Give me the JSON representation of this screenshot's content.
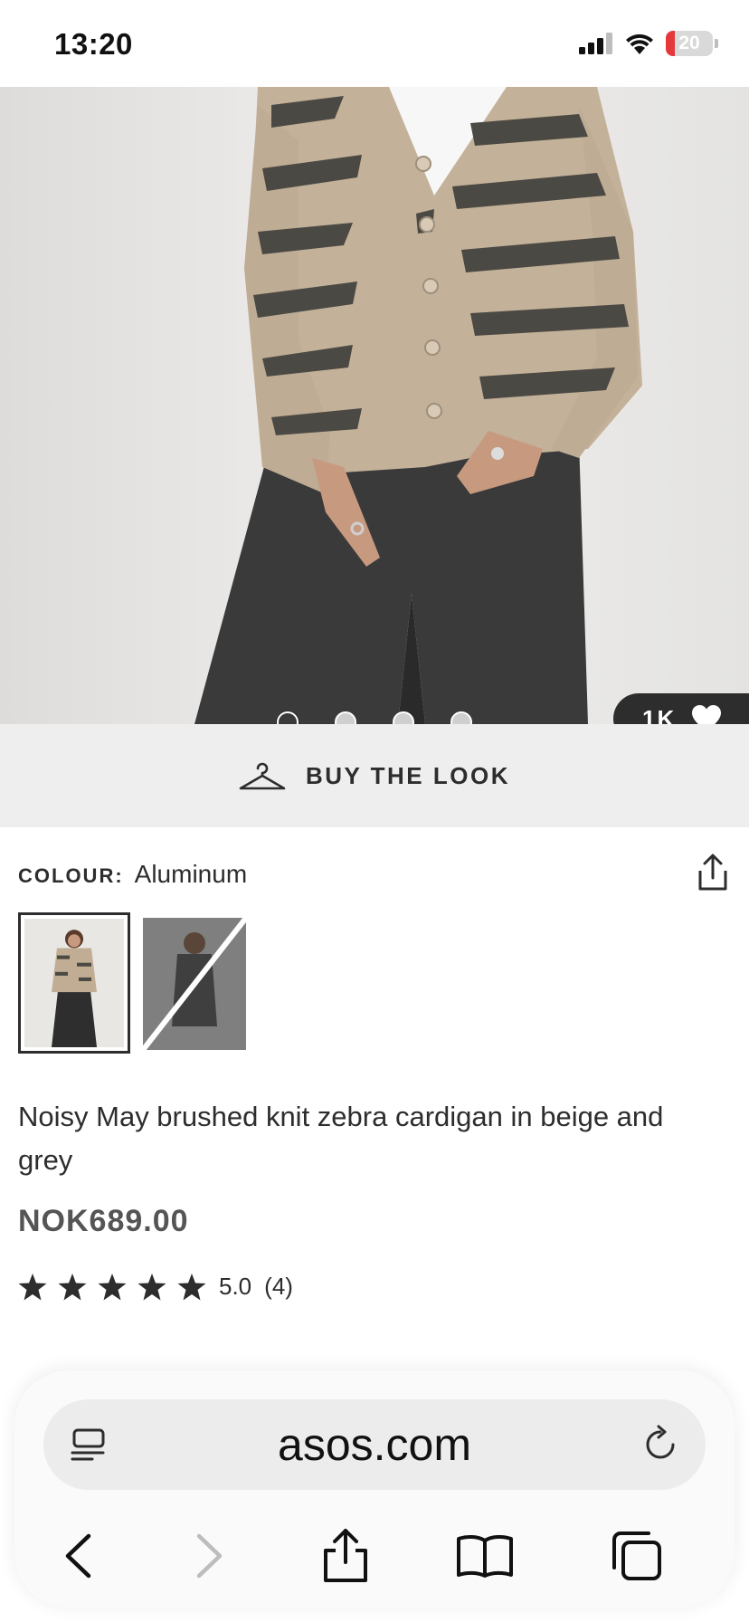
{
  "status_bar": {
    "time": "13:20",
    "battery": "20",
    "battery_level": 0.2
  },
  "gallery": {
    "image_count": 4,
    "active_index": 0,
    "save_count": "1K"
  },
  "buy_the_look": {
    "label": "BUY THE LOOK"
  },
  "colour": {
    "label": "COLOUR:",
    "value": "Aluminum"
  },
  "product": {
    "title": "Noisy May brushed knit zebra cardigan in beige and grey",
    "price": "NOK689.00",
    "rating": {
      "stars": 5,
      "value": "5.0",
      "count": "(4)"
    }
  },
  "browser": {
    "url": "asos.com"
  },
  "colors": {
    "text": "#2d2d2d",
    "price": "#555555",
    "battery_low": "#e5383b",
    "buy_look_bg": "#eeeeee"
  },
  "icons": {
    "signal": "cellular-signal-icon",
    "wifi": "wifi-icon",
    "battery": "battery-icon",
    "heart": "heart-icon",
    "hanger": "hanger-icon",
    "share": "share-icon",
    "star": "star-icon",
    "reader": "reader-icon",
    "reload": "reload-icon",
    "back": "chevron-left-icon",
    "forward": "chevron-right-icon",
    "bookmarks": "book-icon",
    "tabs": "tabs-icon"
  }
}
